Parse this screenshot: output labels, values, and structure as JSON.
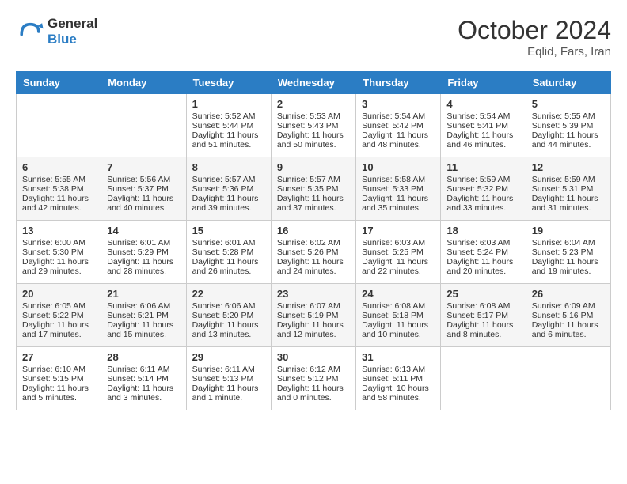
{
  "header": {
    "logo_text_general": "General",
    "logo_text_blue": "Blue",
    "month": "October 2024",
    "location": "Eqlid, Fars, Iran"
  },
  "weekdays": [
    "Sunday",
    "Monday",
    "Tuesday",
    "Wednesday",
    "Thursday",
    "Friday",
    "Saturday"
  ],
  "weeks": [
    [
      {
        "day": "",
        "sunrise": "",
        "sunset": "",
        "daylight": ""
      },
      {
        "day": "",
        "sunrise": "",
        "sunset": "",
        "daylight": ""
      },
      {
        "day": "1",
        "sunrise": "Sunrise: 5:52 AM",
        "sunset": "Sunset: 5:44 PM",
        "daylight": "Daylight: 11 hours and 51 minutes."
      },
      {
        "day": "2",
        "sunrise": "Sunrise: 5:53 AM",
        "sunset": "Sunset: 5:43 PM",
        "daylight": "Daylight: 11 hours and 50 minutes."
      },
      {
        "day": "3",
        "sunrise": "Sunrise: 5:54 AM",
        "sunset": "Sunset: 5:42 PM",
        "daylight": "Daylight: 11 hours and 48 minutes."
      },
      {
        "day": "4",
        "sunrise": "Sunrise: 5:54 AM",
        "sunset": "Sunset: 5:41 PM",
        "daylight": "Daylight: 11 hours and 46 minutes."
      },
      {
        "day": "5",
        "sunrise": "Sunrise: 5:55 AM",
        "sunset": "Sunset: 5:39 PM",
        "daylight": "Daylight: 11 hours and 44 minutes."
      }
    ],
    [
      {
        "day": "6",
        "sunrise": "Sunrise: 5:55 AM",
        "sunset": "Sunset: 5:38 PM",
        "daylight": "Daylight: 11 hours and 42 minutes."
      },
      {
        "day": "7",
        "sunrise": "Sunrise: 5:56 AM",
        "sunset": "Sunset: 5:37 PM",
        "daylight": "Daylight: 11 hours and 40 minutes."
      },
      {
        "day": "8",
        "sunrise": "Sunrise: 5:57 AM",
        "sunset": "Sunset: 5:36 PM",
        "daylight": "Daylight: 11 hours and 39 minutes."
      },
      {
        "day": "9",
        "sunrise": "Sunrise: 5:57 AM",
        "sunset": "Sunset: 5:35 PM",
        "daylight": "Daylight: 11 hours and 37 minutes."
      },
      {
        "day": "10",
        "sunrise": "Sunrise: 5:58 AM",
        "sunset": "Sunset: 5:33 PM",
        "daylight": "Daylight: 11 hours and 35 minutes."
      },
      {
        "day": "11",
        "sunrise": "Sunrise: 5:59 AM",
        "sunset": "Sunset: 5:32 PM",
        "daylight": "Daylight: 11 hours and 33 minutes."
      },
      {
        "day": "12",
        "sunrise": "Sunrise: 5:59 AM",
        "sunset": "Sunset: 5:31 PM",
        "daylight": "Daylight: 11 hours and 31 minutes."
      }
    ],
    [
      {
        "day": "13",
        "sunrise": "Sunrise: 6:00 AM",
        "sunset": "Sunset: 5:30 PM",
        "daylight": "Daylight: 11 hours and 29 minutes."
      },
      {
        "day": "14",
        "sunrise": "Sunrise: 6:01 AM",
        "sunset": "Sunset: 5:29 PM",
        "daylight": "Daylight: 11 hours and 28 minutes."
      },
      {
        "day": "15",
        "sunrise": "Sunrise: 6:01 AM",
        "sunset": "Sunset: 5:28 PM",
        "daylight": "Daylight: 11 hours and 26 minutes."
      },
      {
        "day": "16",
        "sunrise": "Sunrise: 6:02 AM",
        "sunset": "Sunset: 5:26 PM",
        "daylight": "Daylight: 11 hours and 24 minutes."
      },
      {
        "day": "17",
        "sunrise": "Sunrise: 6:03 AM",
        "sunset": "Sunset: 5:25 PM",
        "daylight": "Daylight: 11 hours and 22 minutes."
      },
      {
        "day": "18",
        "sunrise": "Sunrise: 6:03 AM",
        "sunset": "Sunset: 5:24 PM",
        "daylight": "Daylight: 11 hours and 20 minutes."
      },
      {
        "day": "19",
        "sunrise": "Sunrise: 6:04 AM",
        "sunset": "Sunset: 5:23 PM",
        "daylight": "Daylight: 11 hours and 19 minutes."
      }
    ],
    [
      {
        "day": "20",
        "sunrise": "Sunrise: 6:05 AM",
        "sunset": "Sunset: 5:22 PM",
        "daylight": "Daylight: 11 hours and 17 minutes."
      },
      {
        "day": "21",
        "sunrise": "Sunrise: 6:06 AM",
        "sunset": "Sunset: 5:21 PM",
        "daylight": "Daylight: 11 hours and 15 minutes."
      },
      {
        "day": "22",
        "sunrise": "Sunrise: 6:06 AM",
        "sunset": "Sunset: 5:20 PM",
        "daylight": "Daylight: 11 hours and 13 minutes."
      },
      {
        "day": "23",
        "sunrise": "Sunrise: 6:07 AM",
        "sunset": "Sunset: 5:19 PM",
        "daylight": "Daylight: 11 hours and 12 minutes."
      },
      {
        "day": "24",
        "sunrise": "Sunrise: 6:08 AM",
        "sunset": "Sunset: 5:18 PM",
        "daylight": "Daylight: 11 hours and 10 minutes."
      },
      {
        "day": "25",
        "sunrise": "Sunrise: 6:08 AM",
        "sunset": "Sunset: 5:17 PM",
        "daylight": "Daylight: 11 hours and 8 minutes."
      },
      {
        "day": "26",
        "sunrise": "Sunrise: 6:09 AM",
        "sunset": "Sunset: 5:16 PM",
        "daylight": "Daylight: 11 hours and 6 minutes."
      }
    ],
    [
      {
        "day": "27",
        "sunrise": "Sunrise: 6:10 AM",
        "sunset": "Sunset: 5:15 PM",
        "daylight": "Daylight: 11 hours and 5 minutes."
      },
      {
        "day": "28",
        "sunrise": "Sunrise: 6:11 AM",
        "sunset": "Sunset: 5:14 PM",
        "daylight": "Daylight: 11 hours and 3 minutes."
      },
      {
        "day": "29",
        "sunrise": "Sunrise: 6:11 AM",
        "sunset": "Sunset: 5:13 PM",
        "daylight": "Daylight: 11 hours and 1 minute."
      },
      {
        "day": "30",
        "sunrise": "Sunrise: 6:12 AM",
        "sunset": "Sunset: 5:12 PM",
        "daylight": "Daylight: 11 hours and 0 minutes."
      },
      {
        "day": "31",
        "sunrise": "Sunrise: 6:13 AM",
        "sunset": "Sunset: 5:11 PM",
        "daylight": "Daylight: 10 hours and 58 minutes."
      },
      {
        "day": "",
        "sunrise": "",
        "sunset": "",
        "daylight": ""
      },
      {
        "day": "",
        "sunrise": "",
        "sunset": "",
        "daylight": ""
      }
    ]
  ]
}
